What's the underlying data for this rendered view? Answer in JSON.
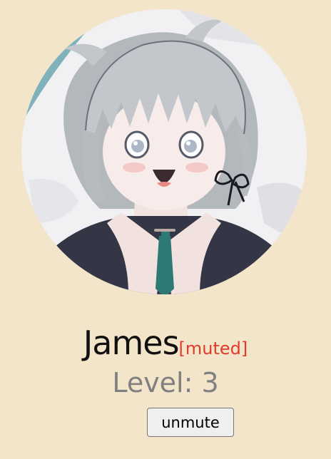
{
  "profile": {
    "name": "James",
    "status_tag": "[muted]",
    "level_text": "Level: 3",
    "action_label": "unmute"
  },
  "colors": {
    "background": "#f2e5c9",
    "name": "#111111",
    "muted": "#e23a2b",
    "level": "#808080"
  }
}
